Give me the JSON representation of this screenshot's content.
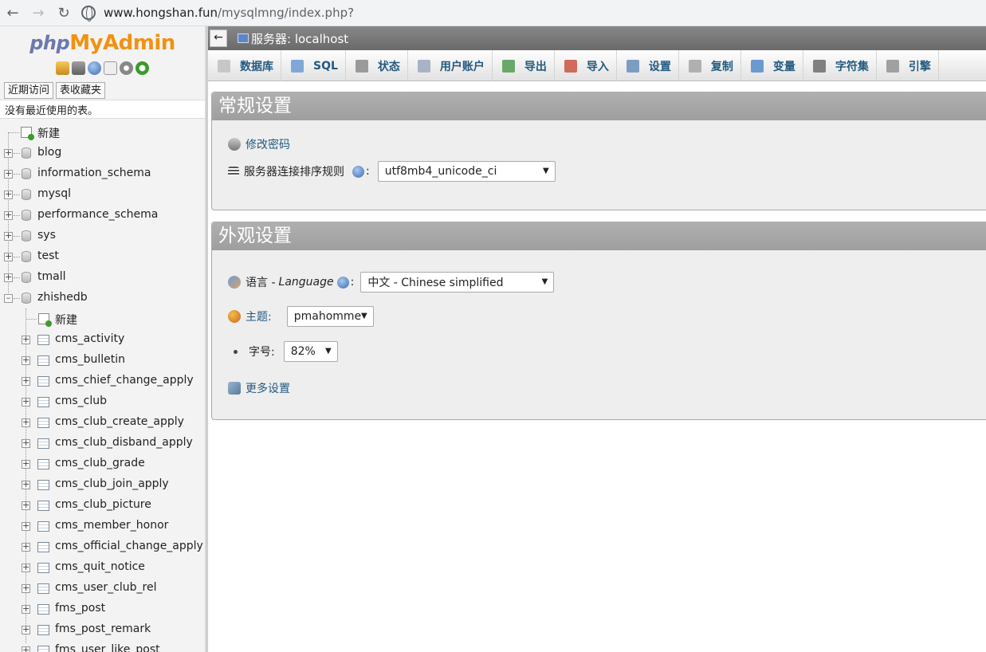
{
  "browser": {
    "url_host": "www.hongshan.fun",
    "url_path": "/mysqlmng/index.php?"
  },
  "sidebar": {
    "logo_php": "php",
    "logo_my": "My",
    "logo_admin": "Admin",
    "tabs": [
      "近期访问",
      "表收藏夹"
    ],
    "recent_text": "没有最近使用的表。",
    "new_label": "新建",
    "databases": [
      "blog",
      "information_schema",
      "mysql",
      "performance_schema",
      "sys",
      "test",
      "tmall",
      "zhishedb"
    ],
    "expanded_db": {
      "new_label": "新建",
      "tables": [
        "cms_activity",
        "cms_bulletin",
        "cms_chief_change_apply",
        "cms_club",
        "cms_club_create_apply",
        "cms_club_disband_apply",
        "cms_club_grade",
        "cms_club_join_apply",
        "cms_club_picture",
        "cms_member_honor",
        "cms_official_change_apply",
        "cms_quit_notice",
        "cms_user_club_rel",
        "fms_post",
        "fms_post_remark",
        "fms_user_like_post"
      ]
    }
  },
  "main": {
    "collapse_label": "←",
    "server_label": "服务器: localhost",
    "menu": [
      {
        "label": "数据库",
        "icon": "database-icon",
        "color": "#c7c7c7"
      },
      {
        "label": "SQL",
        "icon": "sql-icon",
        "color": "#7fa8d8"
      },
      {
        "label": "状态",
        "icon": "status-icon",
        "color": "#9a9a9a"
      },
      {
        "label": "用户账户",
        "icon": "users-icon",
        "color": "#a8b4c4"
      },
      {
        "label": "导出",
        "icon": "export-icon",
        "color": "#6aa86a"
      },
      {
        "label": "导入",
        "icon": "import-icon",
        "color": "#d06a5a"
      },
      {
        "label": "设置",
        "icon": "wrench-icon",
        "color": "#7c9cc0"
      },
      {
        "label": "复制",
        "icon": "replication-icon",
        "color": "#b0b0b0"
      },
      {
        "label": "变量",
        "icon": "variables-icon",
        "color": "#6a9ad0"
      },
      {
        "label": "字符集",
        "icon": "charset-icon",
        "color": "#808080"
      },
      {
        "label": "引擎",
        "icon": "engine-icon",
        "color": "#a0a0a0"
      }
    ],
    "general": {
      "title": "常规设置",
      "change_password": "修改密码",
      "collation_label": "服务器连接排序规则",
      "collation_colon": ":",
      "collation_value": "utf8mb4_unicode_ci"
    },
    "appearance": {
      "title": "外观设置",
      "language_label": "语言 - ",
      "language_en": "Language",
      "language_colon": ":",
      "language_value": "中文 - Chinese simplified",
      "theme_label": "主题:",
      "theme_value": "pmahomme",
      "fontsize_label": "字号:",
      "fontsize_value": "82%",
      "more_settings": "更多设置"
    }
  }
}
